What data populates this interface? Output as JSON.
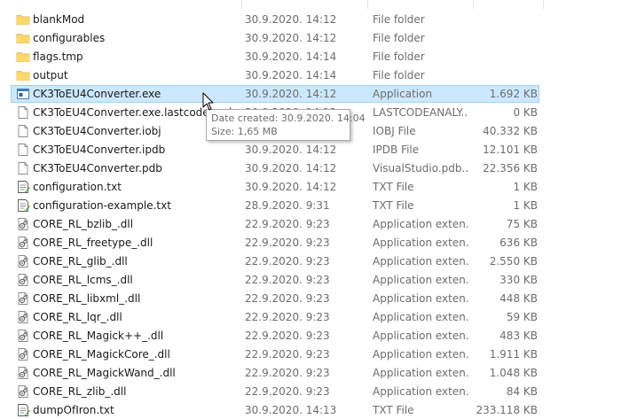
{
  "files": [
    {
      "name": "blankMod",
      "date": "30.9.2020. 14:12",
      "type": "File folder",
      "size": "",
      "icon": "folder-icon"
    },
    {
      "name": "configurables",
      "date": "30.9.2020. 14:12",
      "type": "File folder",
      "size": "",
      "icon": "folder-icon"
    },
    {
      "name": "flags.tmp",
      "date": "30.9.2020. 14:14",
      "type": "File folder",
      "size": "",
      "icon": "folder-icon"
    },
    {
      "name": "output",
      "date": "30.9.2020. 14:14",
      "type": "File folder",
      "size": "",
      "icon": "folder-icon"
    },
    {
      "name": "CK3ToEU4Converter.exe",
      "date": "30.9.2020. 14:12",
      "type": "Application",
      "size": "1.692 KB",
      "icon": "application-icon"
    },
    {
      "name": "CK3ToEU4Converter.exe.lastcodeanalysissucceeded",
      "date": "30.9.2020. 14:12",
      "type": "LASTCODEANALY...",
      "size": "0 KB",
      "icon": "file-icon"
    },
    {
      "name": "CK3ToEU4Converter.iobj",
      "date": "30.9.2020. 14:12",
      "type": "IOBJ File",
      "size": "40.332 KB",
      "icon": "file-icon"
    },
    {
      "name": "CK3ToEU4Converter.ipdb",
      "date": "30.9.2020. 14:12",
      "type": "IPDB File",
      "size": "12.101 KB",
      "icon": "file-icon"
    },
    {
      "name": "CK3ToEU4Converter.pdb",
      "date": "30.9.2020. 14:12",
      "type": "VisualStudio.pdb....",
      "size": "22.356 KB",
      "icon": "file-icon"
    },
    {
      "name": "configuration.txt",
      "date": "30.9.2020. 14:12",
      "type": "TXT File",
      "size": "1 KB",
      "icon": "text-file-icon"
    },
    {
      "name": "configuration-example.txt",
      "date": "28.9.2020. 9:31",
      "type": "TXT File",
      "size": "1 KB",
      "icon": "text-file-icon"
    },
    {
      "name": "CORE_RL_bzlib_.dll",
      "date": "22.9.2020. 9:23",
      "type": "Application exten...",
      "size": "75 KB",
      "icon": "dll-file-icon"
    },
    {
      "name": "CORE_RL_freetype_.dll",
      "date": "22.9.2020. 9:23",
      "type": "Application exten...",
      "size": "636 KB",
      "icon": "dll-file-icon"
    },
    {
      "name": "CORE_RL_glib_.dll",
      "date": "22.9.2020. 9:23",
      "type": "Application exten...",
      "size": "2.550 KB",
      "icon": "dll-file-icon"
    },
    {
      "name": "CORE_RL_lcms_.dll",
      "date": "22.9.2020. 9:23",
      "type": "Application exten...",
      "size": "330 KB",
      "icon": "dll-file-icon"
    },
    {
      "name": "CORE_RL_libxml_.dll",
      "date": "22.9.2020. 9:23",
      "type": "Application exten...",
      "size": "448 KB",
      "icon": "dll-file-icon"
    },
    {
      "name": "CORE_RL_lqr_.dll",
      "date": "22.9.2020. 9:23",
      "type": "Application exten...",
      "size": "59 KB",
      "icon": "dll-file-icon"
    },
    {
      "name": "CORE_RL_Magick++_.dll",
      "date": "22.9.2020. 9:23",
      "type": "Application exten...",
      "size": "483 KB",
      "icon": "dll-file-icon"
    },
    {
      "name": "CORE_RL_MagickCore_.dll",
      "date": "22.9.2020. 9:23",
      "type": "Application exten...",
      "size": "1.911 KB",
      "icon": "dll-file-icon"
    },
    {
      "name": "CORE_RL_MagickWand_.dll",
      "date": "22.9.2020. 9:23",
      "type": "Application exten...",
      "size": "1.048 KB",
      "icon": "dll-file-icon"
    },
    {
      "name": "CORE_RL_zlib_.dll",
      "date": "22.9.2020. 9:23",
      "type": "Application exten...",
      "size": "84 KB",
      "icon": "dll-file-icon"
    },
    {
      "name": "dumpOfIron.txt",
      "date": "30.9.2020. 14:13",
      "type": "TXT File",
      "size": "233.118 KB",
      "icon": "text-file-icon"
    }
  ],
  "selected_index": 4,
  "tooltip": {
    "date_created": "Date created: 30.9.2020. 14:04",
    "size": "Size: 1,65 MB"
  },
  "colors": {
    "selection_bg": "#cce8ff",
    "selection_border": "#99d1ff",
    "folder": "#f8d775",
    "dim_text": "#6d6d6d"
  }
}
